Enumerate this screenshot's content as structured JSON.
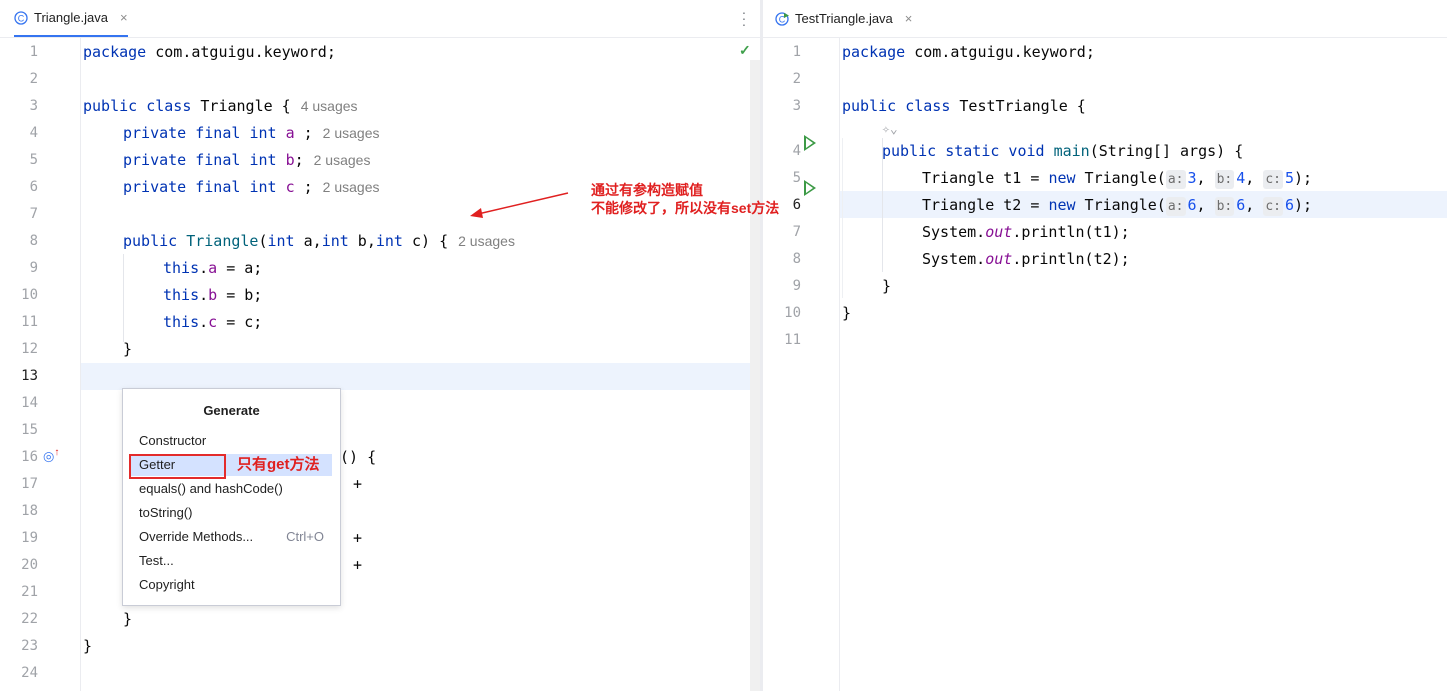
{
  "left_editor": {
    "tab_title": "Triangle.java",
    "tab_close": "×",
    "menu_icon": "more-vertical-icon",
    "status_check": "✓",
    "line_numbers": [
      "1",
      "2",
      "3",
      "4",
      "5",
      "6",
      "7",
      "8",
      "9",
      "10",
      "11",
      "12",
      "13",
      "14",
      "15",
      "16",
      "17",
      "18",
      "19",
      "20",
      "21",
      "22",
      "23",
      "24"
    ],
    "code": {
      "l1_kw": "package",
      "l1_rest": " com.atguigu.keyword;",
      "l3_kw": "public class",
      "l3_rest": " Triangle {",
      "l3_usage": "4 usages",
      "private_final": "private final",
      "int": "int",
      "field_a": "a",
      "field_b": "b",
      "field_c": "c",
      "l4_tail": " ;",
      "l5_tail": ";",
      "l6_tail": " ;",
      "l4_usage": "2 usages",
      "l5_usage": "2 usages",
      "l6_usage": "2 usages",
      "l8_public": "public",
      "l8_name": "Triangle",
      "l8_open": "(",
      "l8_p1": " a,",
      "l8_p2": " b,",
      "l8_p3": " c) {",
      "l8_usage": "2 usages",
      "this": "this",
      "dot": ".",
      "assign_a": " = a;",
      "assign_b": " = b;",
      "assign_c": " = c;",
      "close_brace": "}",
      "l16_tail": "() {",
      "plus": "+"
    },
    "popup": {
      "title": "Generate",
      "items": [
        "Constructor",
        "Getter",
        "equals() and hashCode()",
        "toString()",
        "Override Methods...",
        "Test...",
        "Copyright"
      ],
      "override_shortcut": "Ctrl+O",
      "selected": "Getter"
    },
    "annotations": {
      "getter_note": "只有get方法",
      "arrow_note_line1": "通过有参构造赋值",
      "arrow_note_line2": "不能修改了，所以没有set方法"
    },
    "accent": "#e02020"
  },
  "right_editor": {
    "tab_title": "TestTriangle.java",
    "tab_close": "×",
    "line_numbers": [
      "1",
      "2",
      "3",
      "4",
      "5",
      "6",
      "7",
      "8",
      "9",
      "10",
      "11"
    ],
    "code": {
      "l1_kw": "package",
      "l1_rest": " com.atguigu.keyword;",
      "l3_kw": "public class",
      "l3_rest": " TestTriangle {",
      "l4_kw": "public static void",
      "l4_name": "main",
      "l4_rest": "(String[] args) {",
      "t1_decl": "Triangle t1 = ",
      "t2_decl": "Triangle t2 = ",
      "new": "new",
      "ctor": " Triangle(",
      "hint_a": "a:",
      "hint_b": "b:",
      "hint_c": "c:",
      "t1_a": "3",
      "t1_b": "4",
      "t1_c": "5",
      "t2_a": "6",
      "t2_b": "6",
      "t2_c": "6",
      "comma": ", ",
      "end_stmt": ");",
      "sys": "System.",
      "out": "out",
      "println_t1": ".println(t1);",
      "println_t2": ".println(t2);",
      "close_brace": "}"
    }
  }
}
